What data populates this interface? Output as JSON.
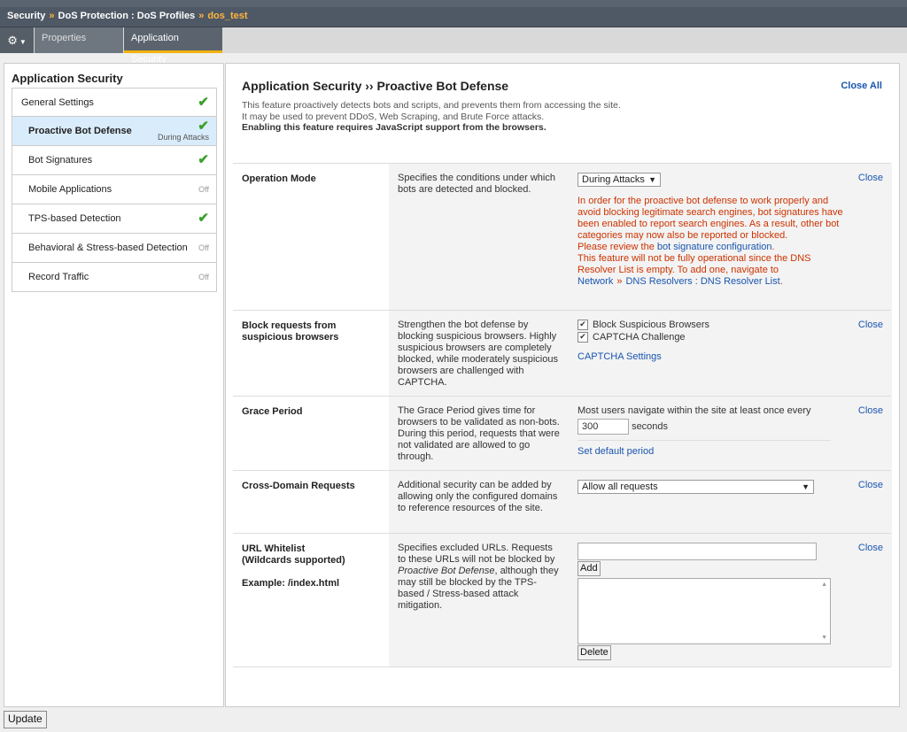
{
  "breadcrumb": {
    "security": "Security",
    "sep": "»",
    "dos_protection": "DoS Protection : DoS Profiles",
    "sep2": "»",
    "current": "dos_test"
  },
  "tabs": {
    "properties": "Properties",
    "application_security": "Application Security"
  },
  "sidebar": {
    "title": "Application Security",
    "items": [
      {
        "label": "General Settings",
        "status": "✔"
      },
      {
        "label": "Proactive Bot Defense",
        "status": "✔",
        "sub": "During Attacks"
      },
      {
        "label": "Bot Signatures",
        "status": "✔"
      },
      {
        "label": "Mobile Applications",
        "status": "Off"
      },
      {
        "label": "TPS-based Detection",
        "status": "✔"
      },
      {
        "label": "Behavioral & Stress-based Detection",
        "status": "Off"
      },
      {
        "label": "Record Traffic",
        "status": "Off"
      }
    ]
  },
  "main": {
    "title": "Application Security ›› Proactive Bot Defense",
    "close_all": "Close All",
    "intro1": "This feature proactively detects bots and scripts, and prevents them from accessing the site.",
    "intro2": "It may be used to prevent DDoS, Web Scraping, and Brute Force attacks.",
    "intro3": "Enabling this feature requires JavaScript support from the browsers."
  },
  "rows": {
    "operation_mode": {
      "name": "Operation Mode",
      "desc": "Specifies the conditions under which bots are detected and blocked.",
      "select": "During Attacks",
      "warn1": "In order for the proactive bot defense to work properly and avoid blocking legitimate search engines, bot signatures have been enabled to report search engines. As a result, other bot categories may now also be reported or blocked.",
      "warn2a": "Please review the ",
      "warn2link": "bot signature configuration",
      "warn2b": ".",
      "warn3": "This feature will not be fully operational since the DNS Resolver List is empty. To add one, navigate to ",
      "warn3link1": "Network",
      "warn3gt": "»",
      "warn3link2": "DNS Resolvers : DNS Resolver List",
      "warn3end": ".",
      "close": "Close"
    },
    "block_requests": {
      "name": "Block requests from suspicious browsers",
      "desc": "Strengthen the bot defense by blocking suspicious browsers. Highly suspicious browsers are completely blocked, while moderately suspicious browsers are challenged with CAPTCHA.",
      "cb1": "Block Suspicious Browsers",
      "cb2": "CAPTCHA Challenge",
      "link": "CAPTCHA Settings",
      "close": "Close"
    },
    "grace_period": {
      "name": "Grace Period",
      "desc": "The Grace Period gives time for browsers to be validated as non-bots. During this period, requests that were not validated are allowed to go through.",
      "line": "Most users navigate within the site at least once every",
      "value": "300",
      "unit": "seconds",
      "link": "Set default period",
      "close": "Close"
    },
    "cross_domain": {
      "name": "Cross-Domain Requests",
      "desc": "Additional security can be added by allowing only the configured domains to reference resources of the site.",
      "select": "Allow all requests",
      "close": "Close"
    },
    "url_whitelist": {
      "name1": "URL Whitelist",
      "name2": "(Wildcards supported)",
      "example": "Example: /index.html",
      "desc1": "Specifies excluded URLs. Requests to these URLs will not be blocked by ",
      "desc_em": "Proactive Bot Defense",
      "desc2": ", although they may still be blocked by the TPS-based / Stress-based attack mitigation.",
      "add": "Add",
      "delete": "Delete",
      "close": "Close"
    }
  },
  "update_button": "Update",
  "colors": {
    "accent": "#f2b30e",
    "link": "#1a55b0",
    "warning": "#cc3300",
    "check": "#3aa12c"
  }
}
